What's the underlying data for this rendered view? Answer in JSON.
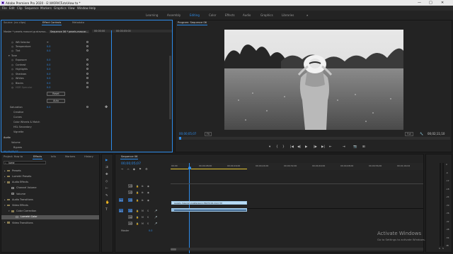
{
  "window": {
    "title": "Adobe Premiere Pro 2020 - E:\\WORK\\Tuto\\How to *",
    "controls": [
      "—",
      "□",
      "✕"
    ]
  },
  "menu": [
    "File",
    "Edit",
    "Clip",
    "Sequence",
    "Markers",
    "Graphics",
    "View",
    "Window",
    "Help"
  ],
  "workspaces": {
    "items": [
      "Learning",
      "Assembly",
      "Editing",
      "Color",
      "Effects",
      "Audio",
      "Graphics",
      "Libraries"
    ],
    "active": "Editing",
    "more": "»"
  },
  "effect_controls": {
    "tabs": [
      "Source: (no clips)",
      "Effect Controls",
      "Metadata"
    ],
    "active_tab": "Effect Controls",
    "source_label": "Master * pexels-mascari-gustavsso...",
    "sequence_label": "Sequence 06 * pexels-mascar...",
    "mini_timecode": "00:00:00",
    "mini_timecode2": "00:00:05:00",
    "properties": [
      {
        "name": "WB Selector",
        "value": ""
      },
      {
        "name": "Temperature",
        "value": "0.0"
      },
      {
        "name": "Tint",
        "value": "0.0"
      },
      {
        "name": "Tone",
        "value": ""
      },
      {
        "name": "Exposure",
        "value": "0.0"
      },
      {
        "name": "Contrast",
        "value": "0.0"
      },
      {
        "name": "Highlights",
        "value": "0.0"
      },
      {
        "name": "Shadows",
        "value": "0.0"
      },
      {
        "name": "Whites",
        "value": "0.0"
      },
      {
        "name": "Blacks",
        "value": "0.0"
      },
      {
        "name": "HDR Specular",
        "value": "0.0"
      }
    ],
    "reset_button": "Reset",
    "auto_button": "Auto",
    "saturation": {
      "name": "Saturation",
      "value": "0.0"
    },
    "sections": [
      "Creative",
      "Curves",
      "Color Wheels & Match",
      "HSL Secondary",
      "Vignette"
    ],
    "audio_header": "Audio",
    "audio_rows": [
      "Volume",
      "Bypass"
    ],
    "timecode": "00;00;05;07"
  },
  "program": {
    "title": "Program: Sequence 06",
    "timecode": "00;00;05;07",
    "fit": "Fit",
    "quality": "Full",
    "duration": "00;02;11;10",
    "transport": [
      "▾",
      "{",
      "}",
      "|◀",
      "◀|",
      "▶",
      "|▶",
      "▶|",
      "⇤",
      "⇥",
      "📷",
      "⊞"
    ]
  },
  "project_panel": {
    "tabs": [
      "Project: How to",
      "Effects",
      "Info",
      "Markers",
      "History"
    ],
    "active_tab": "Effects",
    "search_value": "lume",
    "tree": [
      {
        "label": "Presets",
        "depth": 0,
        "type": "folder"
      },
      {
        "label": "Lumetri Presets",
        "depth": 0,
        "type": "folder"
      },
      {
        "label": "Audio Effects",
        "depth": 0,
        "type": "folder",
        "open": true
      },
      {
        "label": "Channel Volume",
        "depth": 1,
        "type": "fx"
      },
      {
        "label": "Volume",
        "depth": 1,
        "type": "fx"
      },
      {
        "label": "Audio Transitions",
        "depth": 0,
        "type": "folder"
      },
      {
        "label": "Video Effects",
        "depth": 0,
        "type": "folder",
        "open": true
      },
      {
        "label": "Color Correction",
        "depth": 1,
        "type": "folder",
        "open": true
      },
      {
        "label": "Lumetri Color",
        "depth": 2,
        "type": "fx",
        "selected": true
      },
      {
        "label": "Video Transitions",
        "depth": 0,
        "type": "folder"
      }
    ]
  },
  "timeline": {
    "sequence_tab": "Sequence 06",
    "timecode": "00;00;05;07",
    "ruler": [
      "00;00",
      "00;00;08;00",
      "00;00;16;00",
      "00;00;24;00",
      "00;00;32;00",
      "00;00;40;00",
      "00;00;48;00",
      "00;00;56;00",
      "00;01;04;02"
    ],
    "video_tracks": [
      "V3",
      "V2",
      "V1"
    ],
    "audio_tracks": [
      "A1",
      "A2",
      "A3"
    ],
    "source_v": "V1",
    "source_a": "A1",
    "master_label": "Master",
    "master_value": "0.0",
    "video_clip": "pexels-mascari-gustavsson-5647219.mp4 [V]",
    "audio_clip": "",
    "meter_scale": [
      "0",
      "-6",
      "-12",
      "-18",
      "-24",
      "-30",
      "-36",
      "-42",
      "-48",
      "-54",
      "dB"
    ],
    "meter_footer": [
      "S",
      "S"
    ]
  },
  "tools": [
    "▶",
    "⇉",
    "✥",
    "◇",
    "⊢",
    "✎",
    "✋",
    "T"
  ],
  "watermark": {
    "title": "Activate Windows",
    "subtitle": "Go to Settings to activate Windows."
  },
  "colors": {
    "accent": "#2d8ceb",
    "panel": "#232323",
    "background": "#1d1d1d",
    "clip_video": "#b9dcf5",
    "clip_audio": "#8bb8de"
  }
}
